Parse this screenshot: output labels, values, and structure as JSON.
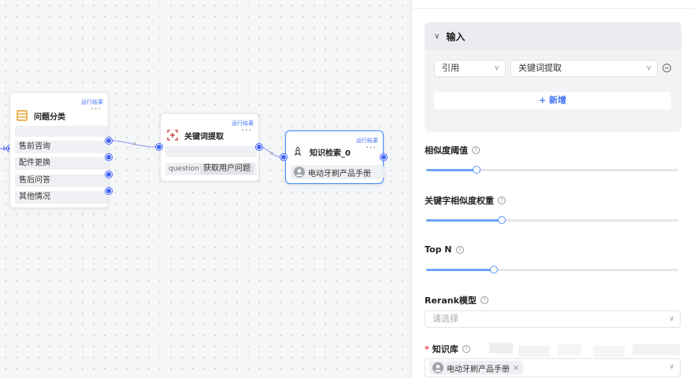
{
  "canvas": {
    "node_classify": {
      "run_result": "运行结果",
      "more": "···",
      "title": "问题分类",
      "categories": [
        "售前咨询",
        "配件更换",
        "售后问答",
        "其他情况"
      ]
    },
    "node_keyword": {
      "run_result": "运行结果",
      "more": "···",
      "title": "关键词提取",
      "param_label": "question",
      "param_value": "获取用户问题"
    },
    "node_knowledge": {
      "run_result": "运行结果",
      "more": "···",
      "title": "知识检索_0",
      "kb_name": "电动牙刷产品手册"
    }
  },
  "panel": {
    "input_section": {
      "title": "输入",
      "ref_select": "引用",
      "source_select": "关键词提取",
      "add_label": "+ 新增"
    },
    "similarity_threshold": {
      "label": "相似度阈值",
      "value": 0.2
    },
    "keyword_weight": {
      "label": "关键字相似度权重",
      "value": 0.3
    },
    "top_n": {
      "label": "Top N",
      "value": 0.27
    },
    "rerank": {
      "label": "Rerank模型",
      "placeholder": "请选择"
    },
    "knowledge_base": {
      "label": "知识库",
      "selected": "电动牙刷产品手册",
      "tag_close": "×"
    },
    "help_glyph": "?",
    "dropdown_glyph": "∨",
    "chevron_glyph": "∨",
    "accent_color": "#3f63f5"
  }
}
